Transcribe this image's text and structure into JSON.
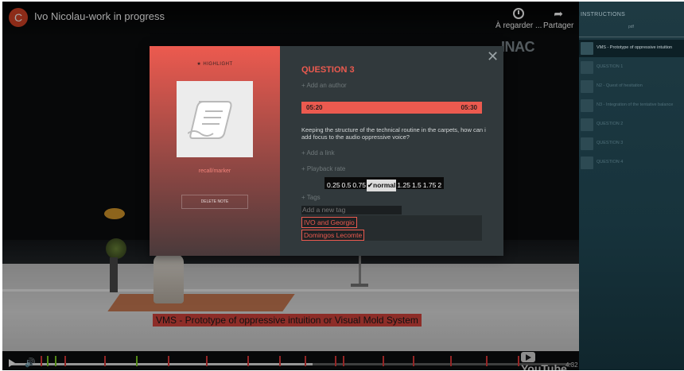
{
  "video": {
    "channel_initial": "C",
    "title": "Ivo Nicolau-work in progress",
    "watch_later_label": "À regarder ...",
    "share_label": "Partager",
    "logo_text": "INAC",
    "subtitle": "VMS - Prototype of oppressive intuition or Visual Mold System",
    "duration": "4:32",
    "youtube_label": "YouTube",
    "progress_fraction": 0.54
  },
  "note_modal": {
    "highlight_label": "★ HIGHLIGHT",
    "note_type": "recall/marker",
    "delete_label": "DELETE NOTE",
    "close_glyph": "✕",
    "title": "QUESTION 3",
    "add_author": "+ Add an author",
    "time_start": "05:20",
    "time_end": "05:30",
    "body": "Keeping the structure of the technical routine in the carpets, how can i add focus to the audio oppressive voice?",
    "add_link": "+ Add a link",
    "playback_rate_label": "+ Playback rate",
    "rates": [
      "0.25",
      "0.5",
      "0.75",
      "✔normal",
      "1.25",
      "1.5",
      "1.75",
      "2"
    ],
    "selected_rate": "✔normal",
    "tags_label": "+ Tags",
    "tag_input_placeholder": "Add a new tag",
    "tags": [
      "IVO and Georgio",
      "Domingos Lecomte"
    ]
  },
  "sidebar": {
    "title": "INSTRUCTIONS",
    "subtitle": "pdf",
    "items": [
      {
        "label": "VMS - Prototype of oppressive intuition",
        "active": true
      },
      {
        "label": "QUESTION 1",
        "active": false
      },
      {
        "label": "N2 - Quest of hesitation",
        "active": false
      },
      {
        "label": "N3 - Integration of the tentative balance",
        "active": false
      },
      {
        "label": "QUESTION 2",
        "active": false
      },
      {
        "label": "QUESTION 3",
        "active": false
      },
      {
        "label": "QUESTION 4",
        "active": false
      }
    ]
  },
  "colors": {
    "accent": "#ec5a4f",
    "modal_bg": "#31393c",
    "sidebar_bg": "#1e3a43"
  }
}
